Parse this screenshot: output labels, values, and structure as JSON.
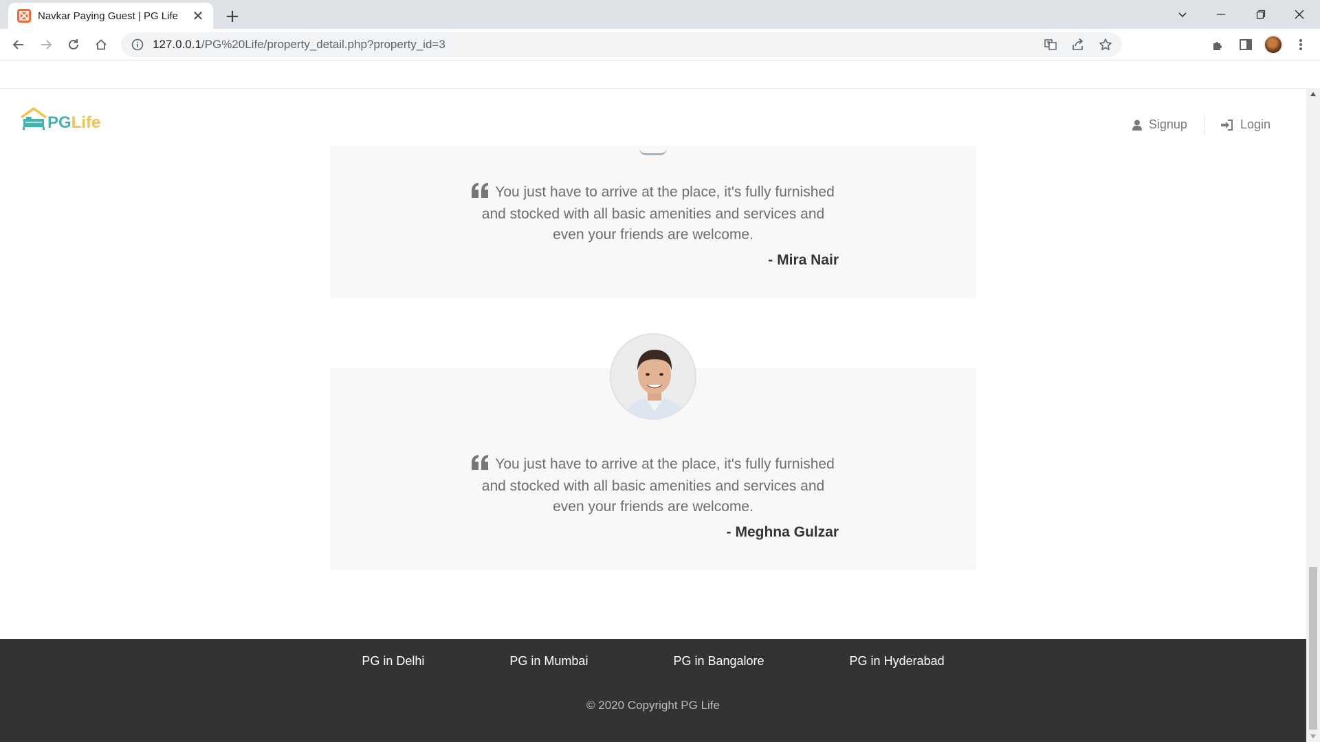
{
  "browser": {
    "tab_title": "Navkar Paying Guest | PG Life",
    "tab_close": "✕",
    "new_tab": "+",
    "url_host": "127.0.0.1",
    "url_path": "/PG%20Life/property_detail.php?property_id=3"
  },
  "header": {
    "logo_pg": "PG",
    "logo_life": "Life",
    "signup_label": "Signup",
    "login_label": "Login"
  },
  "testimonials": [
    {
      "quote": "You just have to arrive at the place, it's fully furnished and stocked with all basic amenities and services and even your friends are welcome.",
      "author": "- Mira Nair"
    },
    {
      "quote": "You just have to arrive at the place, it's fully furnished and stocked with all basic amenities and services and even your friends are welcome.",
      "author": "- Meghna Gulzar"
    }
  ],
  "footer": {
    "links": [
      "PG in Delhi",
      "PG in Mumbai",
      "PG in Bangalore",
      "PG in Hyderabad"
    ],
    "copyright": "© 2020 Copyright PG Life"
  },
  "colors": {
    "brand_teal": "#43b4b0",
    "brand_yellow": "#f2c14e",
    "card_bg": "#f9f8f6",
    "footer_bg": "#333333"
  }
}
